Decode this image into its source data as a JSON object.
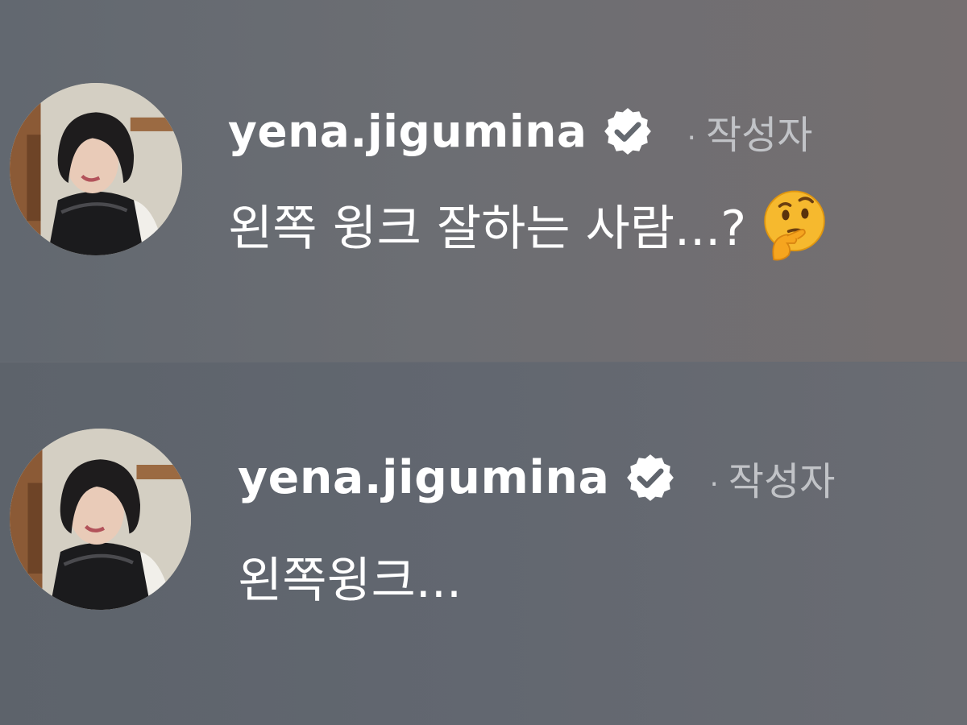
{
  "comments": [
    {
      "username": "yena.jigumina",
      "author_tag": "작성자",
      "author_dot": "·",
      "text": "왼쪽 윙크 잘하는 사람...?",
      "emoji_icon": "thinking-face-icon",
      "verified_icon": "verified-badge-icon"
    },
    {
      "username": "yena.jigumina",
      "author_tag": "작성자",
      "author_dot": "·",
      "text": "왼쪽윙크...",
      "verified_icon": "verified-badge-icon"
    }
  ],
  "colors": {
    "text_primary": "#ffffff",
    "text_secondary": "#c1c3c7",
    "background": "#64686f",
    "emoji_yellow": "#f4b400"
  }
}
